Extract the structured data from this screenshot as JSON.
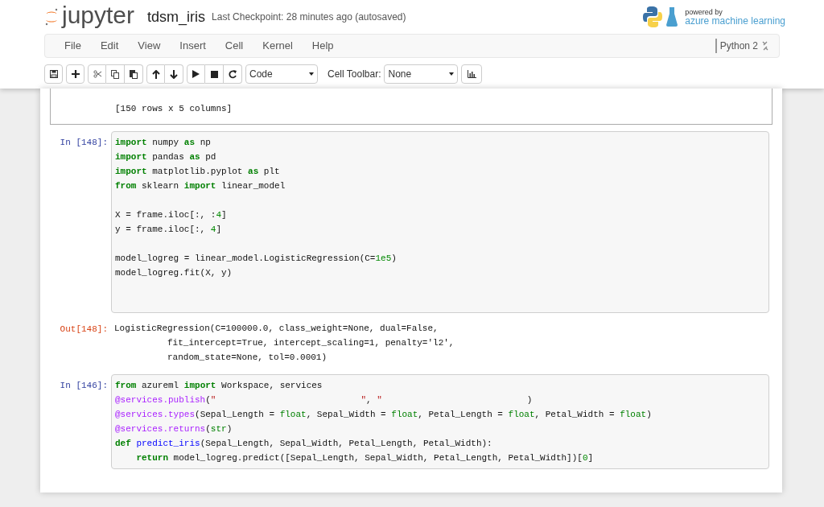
{
  "header": {
    "logo": "jupyter",
    "notebook_name": "tdsm_iris",
    "checkpoint": "Last Checkpoint: 28 minutes ago (autosaved)",
    "powered_by": "powered by",
    "brand": "azure machine learning"
  },
  "menu": [
    "File",
    "Edit",
    "View",
    "Insert",
    "Cell",
    "Kernel",
    "Help"
  ],
  "kernel": "Python 2",
  "toolbar": {
    "cell_type": "Code",
    "cell_toolbar_label": "Cell Toolbar:",
    "cell_toolbar": "None"
  },
  "cells": [
    {
      "kind": "output_only",
      "lines": [
        "[150 rows x 5 columns]"
      ]
    },
    {
      "kind": "code",
      "prompt": "In [148]:",
      "lines": [
        {
          "kind": "code",
          "tokens": [
            {
              "kind": "keyword",
              "text": "import"
            },
            {
              "kind": "plain",
              "text": " numpy "
            },
            {
              "kind": "keyword",
              "text": "as"
            },
            {
              "kind": "plain",
              "text": " np"
            }
          ]
        },
        {
          "kind": "code",
          "tokens": [
            {
              "kind": "keyword",
              "text": "import"
            },
            {
              "kind": "plain",
              "text": " pandas "
            },
            {
              "kind": "keyword",
              "text": "as"
            },
            {
              "kind": "plain",
              "text": " pd"
            }
          ]
        },
        {
          "kind": "code",
          "tokens": [
            {
              "kind": "keyword",
              "text": "import"
            },
            {
              "kind": "plain",
              "text": " matplotlib.pyplot "
            },
            {
              "kind": "keyword",
              "text": "as"
            },
            {
              "kind": "plain",
              "text": " plt"
            }
          ]
        },
        {
          "kind": "code",
          "tokens": [
            {
              "kind": "keyword",
              "text": "from"
            },
            {
              "kind": "plain",
              "text": " sklearn "
            },
            {
              "kind": "keyword",
              "text": "import"
            },
            {
              "kind": "plain",
              "text": " linear_model"
            }
          ]
        },
        {
          "kind": "blank"
        },
        {
          "kind": "code",
          "tokens": [
            {
              "kind": "plain",
              "text": "X = frame.iloc[:, :"
            },
            {
              "kind": "number",
              "text": "4"
            },
            {
              "kind": "plain",
              "text": "]"
            }
          ]
        },
        {
          "kind": "code",
          "tokens": [
            {
              "kind": "plain",
              "text": "y = frame.iloc[:, "
            },
            {
              "kind": "number",
              "text": "4"
            },
            {
              "kind": "plain",
              "text": "]"
            }
          ]
        },
        {
          "kind": "blank"
        },
        {
          "kind": "code",
          "tokens": [
            {
              "kind": "plain",
              "text": "model_logreg = linear_model.LogisticRegression(C="
            },
            {
              "kind": "number",
              "text": "1e5"
            },
            {
              "kind": "plain",
              "text": ")"
            }
          ]
        },
        {
          "kind": "code",
          "tokens": [
            {
              "kind": "plain",
              "text": "model_logreg.fit(X, y)"
            }
          ]
        },
        {
          "kind": "blank"
        },
        {
          "kind": "blank"
        }
      ],
      "output": {
        "prompt": "Out[148]:",
        "lines": [
          "LogisticRegression(C=100000.0, class_weight=None, dual=False,",
          "          fit_intercept=True, intercept_scaling=1, penalty='l2',",
          "          random_state=None, tol=0.0001)"
        ]
      }
    },
    {
      "kind": "code",
      "prompt": "In [146]:",
      "lines": [
        {
          "kind": "code",
          "tokens": [
            {
              "kind": "keyword",
              "text": "from"
            },
            {
              "kind": "plain",
              "text": " azureml "
            },
            {
              "kind": "keyword",
              "text": "import"
            },
            {
              "kind": "plain",
              "text": " Workspace, services"
            }
          ]
        },
        {
          "kind": "code",
          "tokens": [
            {
              "kind": "decorator",
              "text": "@services.publish"
            },
            {
              "kind": "plain",
              "text": "("
            },
            {
              "kind": "string",
              "text": "\""
            },
            {
              "kind": "redacted"
            },
            {
              "kind": "string",
              "text": "\""
            },
            {
              "kind": "plain",
              "text": ", "
            },
            {
              "kind": "string",
              "text": "\""
            },
            {
              "kind": "redacted"
            },
            {
              "kind": "plain",
              "text": ")"
            }
          ]
        },
        {
          "kind": "code",
          "tokens": [
            {
              "kind": "decorator",
              "text": "@services.types"
            },
            {
              "kind": "plain",
              "text": "(Sepal_Length = "
            },
            {
              "kind": "builtin",
              "text": "float"
            },
            {
              "kind": "plain",
              "text": ", Sepal_Width = "
            },
            {
              "kind": "builtin",
              "text": "float"
            },
            {
              "kind": "plain",
              "text": ", Petal_Length = "
            },
            {
              "kind": "builtin",
              "text": "float"
            },
            {
              "kind": "plain",
              "text": ", Petal_Width = "
            },
            {
              "kind": "builtin",
              "text": "float"
            },
            {
              "kind": "plain",
              "text": ")"
            }
          ]
        },
        {
          "kind": "code",
          "tokens": [
            {
              "kind": "decorator",
              "text": "@services.returns"
            },
            {
              "kind": "plain",
              "text": "("
            },
            {
              "kind": "builtin",
              "text": "str"
            },
            {
              "kind": "plain",
              "text": ")"
            }
          ]
        },
        {
          "kind": "code",
          "tokens": [
            {
              "kind": "keyword",
              "text": "def"
            },
            {
              "kind": "function",
              "text": " predict_iris"
            },
            {
              "kind": "plain",
              "text": "(Sepal_Length, Sepal_Width, Petal_Length, Petal_Width):"
            }
          ]
        },
        {
          "kind": "code",
          "tokens": [
            {
              "kind": "keyword",
              "text": "    return"
            },
            {
              "kind": "plain",
              "text": " model_logreg.predict([Sepal_Length, Sepal_Width, Petal_Length, Petal_Width])["
            },
            {
              "kind": "number",
              "text": "0"
            },
            {
              "kind": "plain",
              "text": "]"
            }
          ]
        }
      ]
    }
  ]
}
